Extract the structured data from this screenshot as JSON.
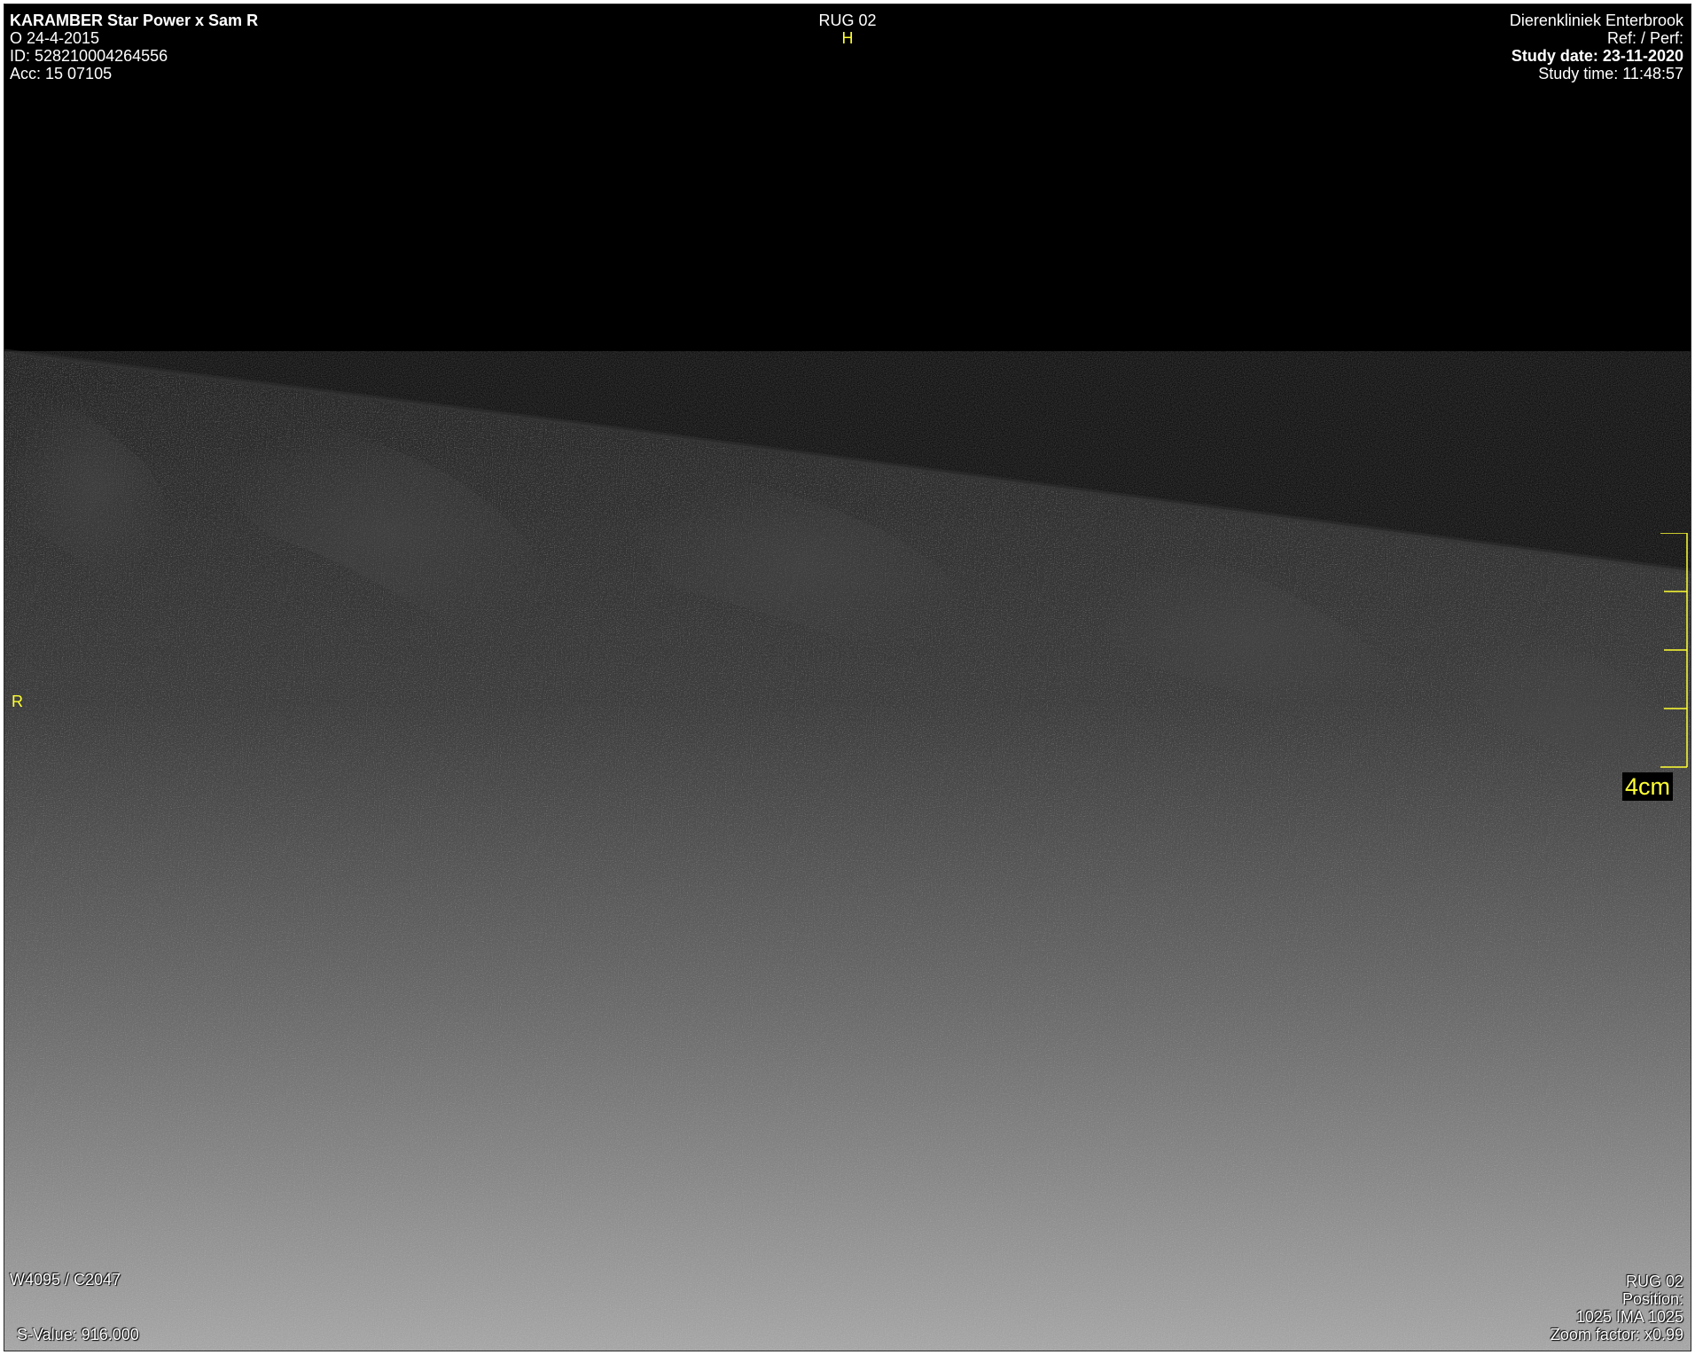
{
  "top_left": {
    "patient_name": "KARAMBER  Star Power x Sam R",
    "birth_line": "O  24-4-2015",
    "id_line": "ID: 528210004264556",
    "acc_line": "Acc: 15 07105"
  },
  "top_center": {
    "series": "RUG 02",
    "orientation_top": "H"
  },
  "top_right": {
    "institution": "Dierenkliniek Enterbrook",
    "ref_perf": "Ref:  / Perf:",
    "study_date": "Study date: 23-11-2020",
    "study_time": "Study time: 11:48:57"
  },
  "left_orientation": "R",
  "scale": {
    "label": "4cm",
    "color": "#ffff33"
  },
  "bottom_left": {
    "window_level": "W4095 / C2047",
    "s_value": "S-Value: 916.000"
  },
  "bottom_right": {
    "series": "RUG 02",
    "position": "Position:",
    "image_index": "1025 IMA 1025",
    "zoom": "Zoom factor: x0.99"
  },
  "colors": {
    "overlay_text": "#ffffff",
    "orientation_marker": "#ffff33",
    "background": "#000000"
  }
}
